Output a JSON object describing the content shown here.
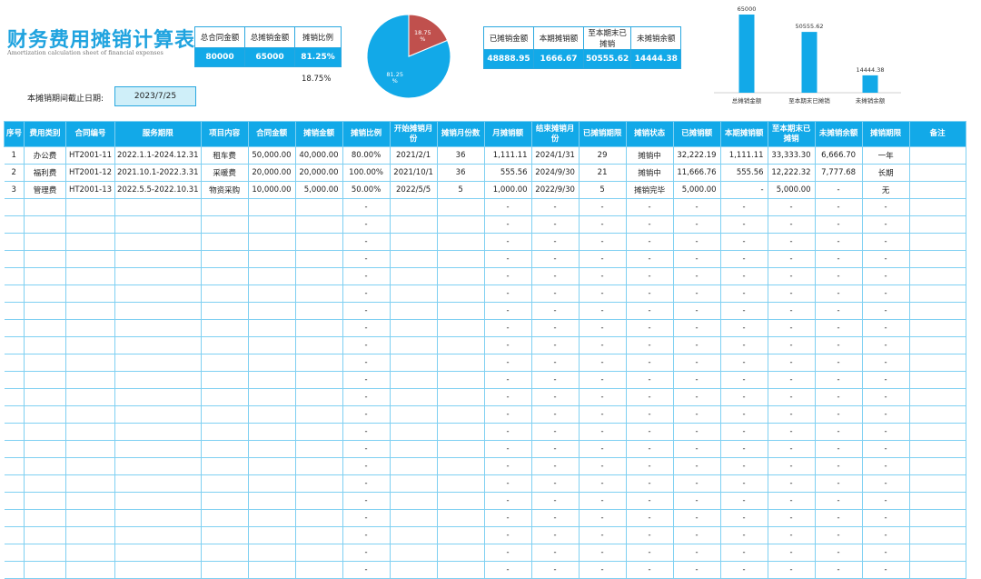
{
  "header": {
    "title": "财务费用摊销计算表",
    "subtitle": "Amortization calculation sheet of financial expenses"
  },
  "summary": {
    "labels": [
      "总合同金额",
      "总摊销金额",
      "摊销比例"
    ],
    "values": [
      "80000",
      "65000",
      "81.25%"
    ],
    "remaining_pct": "18.75%"
  },
  "summary2": {
    "labels": [
      "已摊销金额",
      "本期摊销额",
      "至本期末已摊销",
      "未摊销余额"
    ],
    "values": [
      "48888.95",
      "1666.67",
      "50555.62",
      "14444.38"
    ]
  },
  "cutoff": {
    "label": "本摊销期间截止日期:",
    "value": "2023/7/25"
  },
  "colors": {
    "accent": "#12a9e8",
    "pie_red": "#c0504d",
    "pie_blue": "#12a9e8"
  },
  "chart_data": [
    {
      "type": "pie",
      "slices": [
        {
          "label": "81.25%",
          "value": 81.25,
          "color": "#12a9e8"
        },
        {
          "label": "18.75%",
          "value": 18.75,
          "color": "#c0504d"
        }
      ]
    },
    {
      "type": "bar",
      "categories": [
        "总摊销金额",
        "至本期末已摊销",
        "未摊销余额"
      ],
      "values": [
        65000,
        50555.62,
        14444.38
      ],
      "value_labels": [
        "65000",
        "50555.62",
        "14444.38"
      ]
    }
  ],
  "table": {
    "headers": [
      "序号",
      "费用类别",
      "合同编号",
      "服务期限",
      "项目内容",
      "合同金额",
      "摊销金额",
      "摊销比例",
      "开始摊销月份",
      "摊销月份数",
      "月摊销额",
      "结束摊销月份",
      "已摊销期限",
      "摊销状态",
      "已摊销额",
      "本期摊销额",
      "至本期末已摊销",
      "未摊销余额",
      "摊销期限",
      "备注"
    ],
    "rows": [
      [
        "1",
        "办公费",
        "HT2001-11",
        "2022.1.1-2024.12.31",
        "租车费",
        "50,000.00",
        "40,000.00",
        "80.00%",
        "2021/2/1",
        "36",
        "1,111.11",
        "2024/1/31",
        "29",
        "摊销中",
        "32,222.19",
        "1,111.11",
        "33,333.30",
        "6,666.70",
        "一年",
        ""
      ],
      [
        "2",
        "福利费",
        "HT2001-12",
        "2021.10.1-2022.3.31",
        "采暖费",
        "20,000.00",
        "20,000.00",
        "100.00%",
        "2021/10/1",
        "36",
        "555.56",
        "2024/9/30",
        "21",
        "摊销中",
        "11,666.76",
        "555.56",
        "12,222.32",
        "7,777.68",
        "长期",
        ""
      ],
      [
        "3",
        "管理费",
        "HT2001-13",
        "2022.5.5-2022.10.31",
        "物资采购",
        "10,000.00",
        "5,000.00",
        "50.00%",
        "2022/5/5",
        "5",
        "1,000.00",
        "2022/9/30",
        "5",
        "摊销完毕",
        "5,000.00",
        "-",
        "5,000.00",
        "-",
        "无",
        ""
      ]
    ],
    "empty_row": [
      "",
      "",
      "",
      "",
      "",
      "",
      "",
      "-",
      "",
      "",
      "-",
      "-",
      "-",
      "-",
      "-",
      "-",
      "-",
      "-",
      "-",
      ""
    ],
    "empty_row_count": 22
  }
}
